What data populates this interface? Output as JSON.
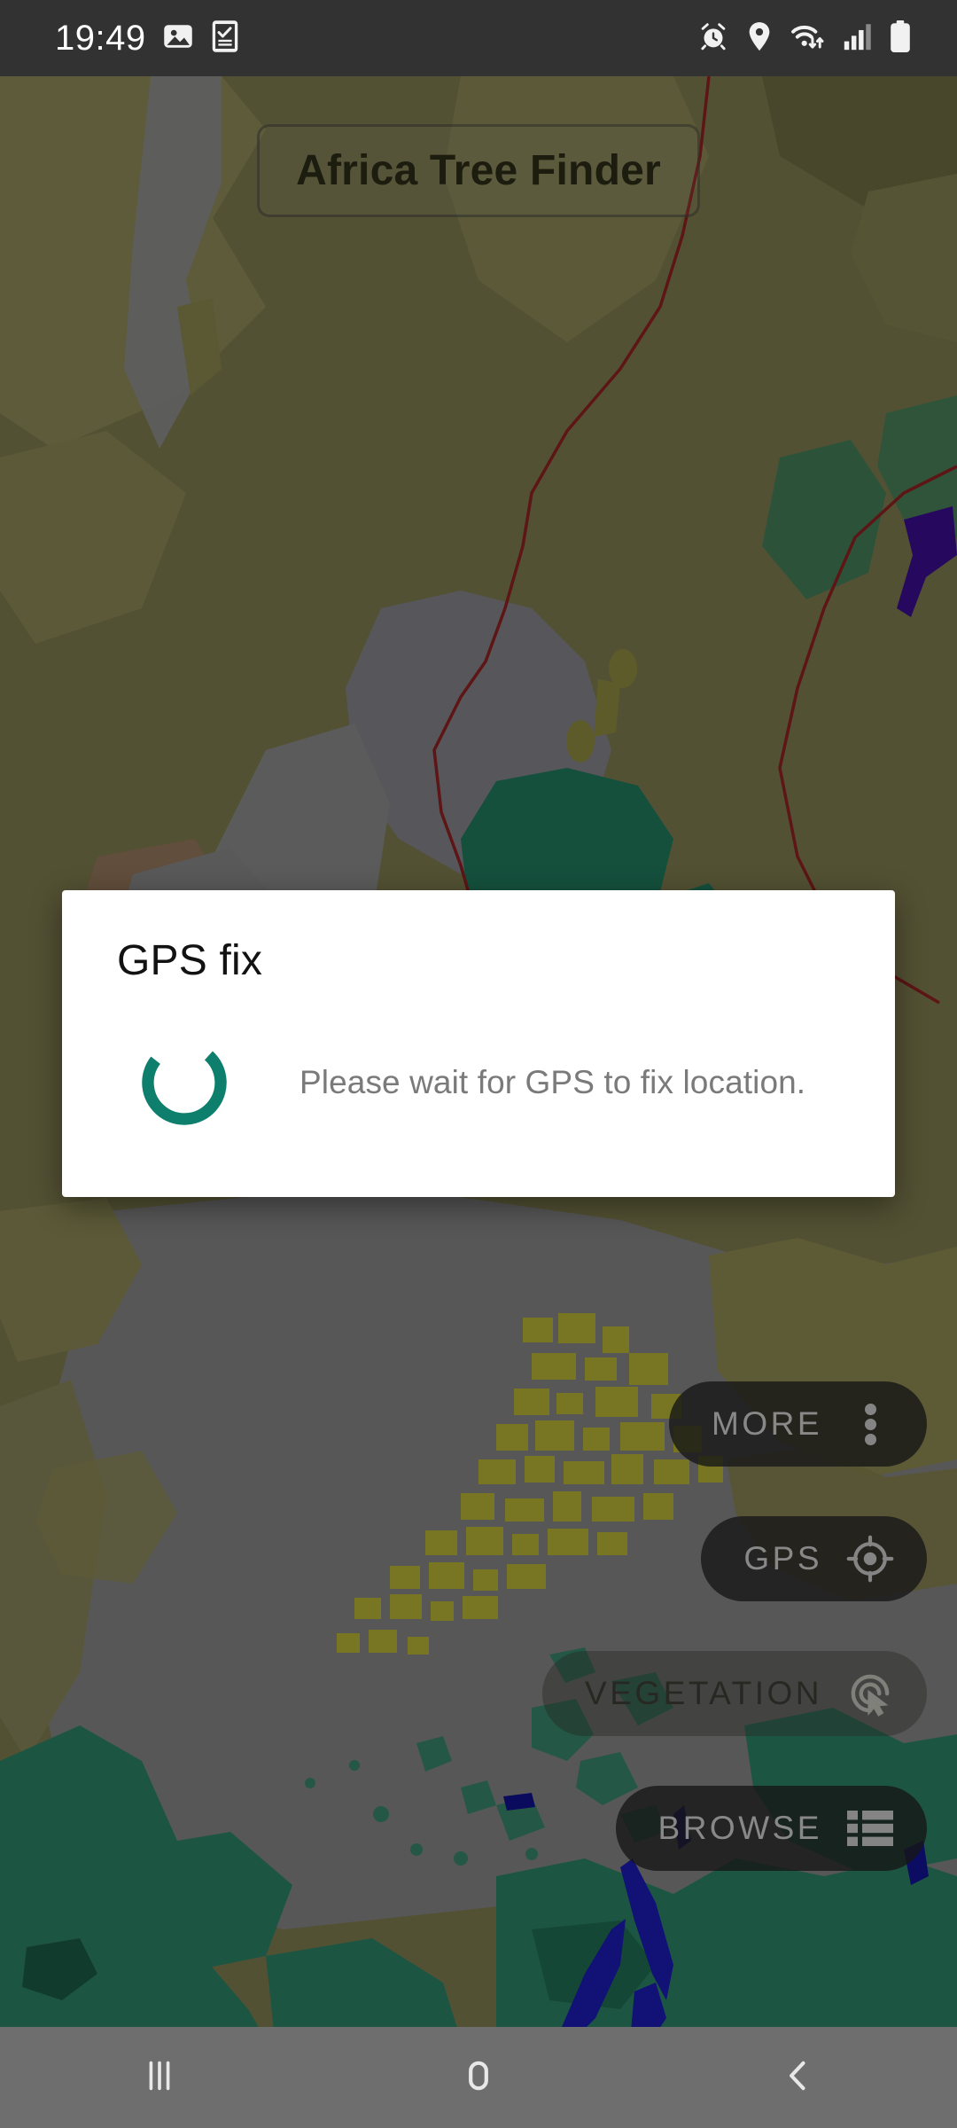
{
  "status_bar": {
    "time": "19:49",
    "left_icons": [
      {
        "name": "photo-image-icon",
        "glyph": "image"
      },
      {
        "name": "device-checklist-icon",
        "glyph": "phone-check"
      }
    ],
    "right_icons": [
      {
        "name": "alarm-clock-icon",
        "glyph": "alarm"
      },
      {
        "name": "location-pin-icon",
        "glyph": "pin"
      },
      {
        "name": "wifi-transfer-icon",
        "glyph": "wifi"
      },
      {
        "name": "cellular-signal-icon",
        "glyph": "signal"
      },
      {
        "name": "battery-icon",
        "glyph": "battery"
      }
    ],
    "background_color": "#323232"
  },
  "app": {
    "title": "Africa Tree Finder"
  },
  "dialog": {
    "title": "GPS fix",
    "message": "Please wait for GPS to fix location.",
    "spinner_color": "#0e7f6c",
    "background_color": "#ffffff",
    "visible": true
  },
  "action_buttons": [
    {
      "label": "MORE",
      "icon": "more-vertical-icon"
    },
    {
      "label": "GPS",
      "icon": "crosshair-target-icon"
    },
    {
      "label": "VEGETATION",
      "icon": "tap-select-icon"
    },
    {
      "label": "BROWSE",
      "icon": "list-view-icon"
    }
  ],
  "map": {
    "colors": {
      "savanna_olive": "#807d4e",
      "olive_light": "#8d8a58",
      "olive_dark": "#6f6d43",
      "grey_region": "#8a8a8a",
      "forest_green": "#1f7a5e",
      "forest_green_light": "#2e8c6d",
      "water_blue": "#1b1bb4",
      "water_purple": "#3a0f8f",
      "border_red": "#8e2020",
      "brown_region": "#9a7560",
      "yellow_raster": "#c8c41f"
    }
  },
  "nav_bar": {
    "buttons": [
      {
        "label": "Recents",
        "icon": "recents-icon"
      },
      {
        "label": "Home",
        "icon": "home-icon"
      },
      {
        "label": "Back",
        "icon": "back-chevron-icon"
      }
    ],
    "background_color": "#6e6e6e"
  }
}
